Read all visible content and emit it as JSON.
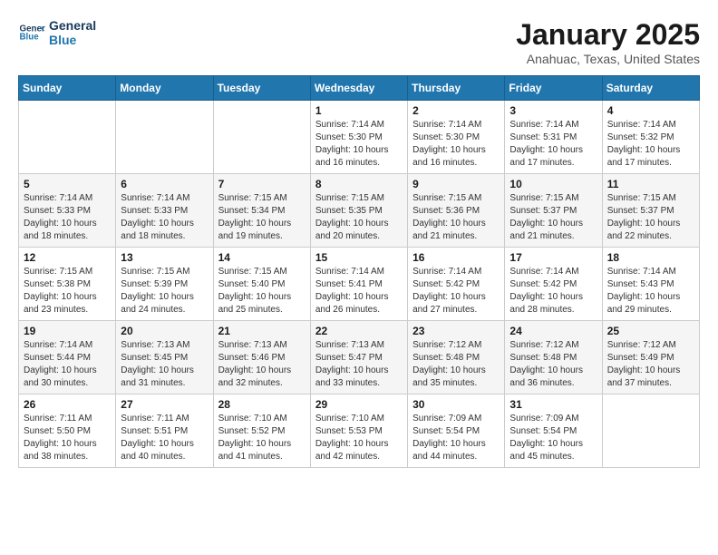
{
  "header": {
    "logo_line1": "General",
    "logo_line2": "Blue",
    "month_title": "January 2025",
    "location": "Anahuac, Texas, United States"
  },
  "weekdays": [
    "Sunday",
    "Monday",
    "Tuesday",
    "Wednesday",
    "Thursday",
    "Friday",
    "Saturday"
  ],
  "weeks": [
    [
      {
        "day": "",
        "info": ""
      },
      {
        "day": "",
        "info": ""
      },
      {
        "day": "",
        "info": ""
      },
      {
        "day": "1",
        "info": "Sunrise: 7:14 AM\nSunset: 5:30 PM\nDaylight: 10 hours\nand 16 minutes."
      },
      {
        "day": "2",
        "info": "Sunrise: 7:14 AM\nSunset: 5:30 PM\nDaylight: 10 hours\nand 16 minutes."
      },
      {
        "day": "3",
        "info": "Sunrise: 7:14 AM\nSunset: 5:31 PM\nDaylight: 10 hours\nand 17 minutes."
      },
      {
        "day": "4",
        "info": "Sunrise: 7:14 AM\nSunset: 5:32 PM\nDaylight: 10 hours\nand 17 minutes."
      }
    ],
    [
      {
        "day": "5",
        "info": "Sunrise: 7:14 AM\nSunset: 5:33 PM\nDaylight: 10 hours\nand 18 minutes."
      },
      {
        "day": "6",
        "info": "Sunrise: 7:14 AM\nSunset: 5:33 PM\nDaylight: 10 hours\nand 18 minutes."
      },
      {
        "day": "7",
        "info": "Sunrise: 7:15 AM\nSunset: 5:34 PM\nDaylight: 10 hours\nand 19 minutes."
      },
      {
        "day": "8",
        "info": "Sunrise: 7:15 AM\nSunset: 5:35 PM\nDaylight: 10 hours\nand 20 minutes."
      },
      {
        "day": "9",
        "info": "Sunrise: 7:15 AM\nSunset: 5:36 PM\nDaylight: 10 hours\nand 21 minutes."
      },
      {
        "day": "10",
        "info": "Sunrise: 7:15 AM\nSunset: 5:37 PM\nDaylight: 10 hours\nand 21 minutes."
      },
      {
        "day": "11",
        "info": "Sunrise: 7:15 AM\nSunset: 5:37 PM\nDaylight: 10 hours\nand 22 minutes."
      }
    ],
    [
      {
        "day": "12",
        "info": "Sunrise: 7:15 AM\nSunset: 5:38 PM\nDaylight: 10 hours\nand 23 minutes."
      },
      {
        "day": "13",
        "info": "Sunrise: 7:15 AM\nSunset: 5:39 PM\nDaylight: 10 hours\nand 24 minutes."
      },
      {
        "day": "14",
        "info": "Sunrise: 7:15 AM\nSunset: 5:40 PM\nDaylight: 10 hours\nand 25 minutes."
      },
      {
        "day": "15",
        "info": "Sunrise: 7:14 AM\nSunset: 5:41 PM\nDaylight: 10 hours\nand 26 minutes."
      },
      {
        "day": "16",
        "info": "Sunrise: 7:14 AM\nSunset: 5:42 PM\nDaylight: 10 hours\nand 27 minutes."
      },
      {
        "day": "17",
        "info": "Sunrise: 7:14 AM\nSunset: 5:42 PM\nDaylight: 10 hours\nand 28 minutes."
      },
      {
        "day": "18",
        "info": "Sunrise: 7:14 AM\nSunset: 5:43 PM\nDaylight: 10 hours\nand 29 minutes."
      }
    ],
    [
      {
        "day": "19",
        "info": "Sunrise: 7:14 AM\nSunset: 5:44 PM\nDaylight: 10 hours\nand 30 minutes."
      },
      {
        "day": "20",
        "info": "Sunrise: 7:13 AM\nSunset: 5:45 PM\nDaylight: 10 hours\nand 31 minutes."
      },
      {
        "day": "21",
        "info": "Sunrise: 7:13 AM\nSunset: 5:46 PM\nDaylight: 10 hours\nand 32 minutes."
      },
      {
        "day": "22",
        "info": "Sunrise: 7:13 AM\nSunset: 5:47 PM\nDaylight: 10 hours\nand 33 minutes."
      },
      {
        "day": "23",
        "info": "Sunrise: 7:12 AM\nSunset: 5:48 PM\nDaylight: 10 hours\nand 35 minutes."
      },
      {
        "day": "24",
        "info": "Sunrise: 7:12 AM\nSunset: 5:48 PM\nDaylight: 10 hours\nand 36 minutes."
      },
      {
        "day": "25",
        "info": "Sunrise: 7:12 AM\nSunset: 5:49 PM\nDaylight: 10 hours\nand 37 minutes."
      }
    ],
    [
      {
        "day": "26",
        "info": "Sunrise: 7:11 AM\nSunset: 5:50 PM\nDaylight: 10 hours\nand 38 minutes."
      },
      {
        "day": "27",
        "info": "Sunrise: 7:11 AM\nSunset: 5:51 PM\nDaylight: 10 hours\nand 40 minutes."
      },
      {
        "day": "28",
        "info": "Sunrise: 7:10 AM\nSunset: 5:52 PM\nDaylight: 10 hours\nand 41 minutes."
      },
      {
        "day": "29",
        "info": "Sunrise: 7:10 AM\nSunset: 5:53 PM\nDaylight: 10 hours\nand 42 minutes."
      },
      {
        "day": "30",
        "info": "Sunrise: 7:09 AM\nSunset: 5:54 PM\nDaylight: 10 hours\nand 44 minutes."
      },
      {
        "day": "31",
        "info": "Sunrise: 7:09 AM\nSunset: 5:54 PM\nDaylight: 10 hours\nand 45 minutes."
      },
      {
        "day": "",
        "info": ""
      }
    ]
  ]
}
